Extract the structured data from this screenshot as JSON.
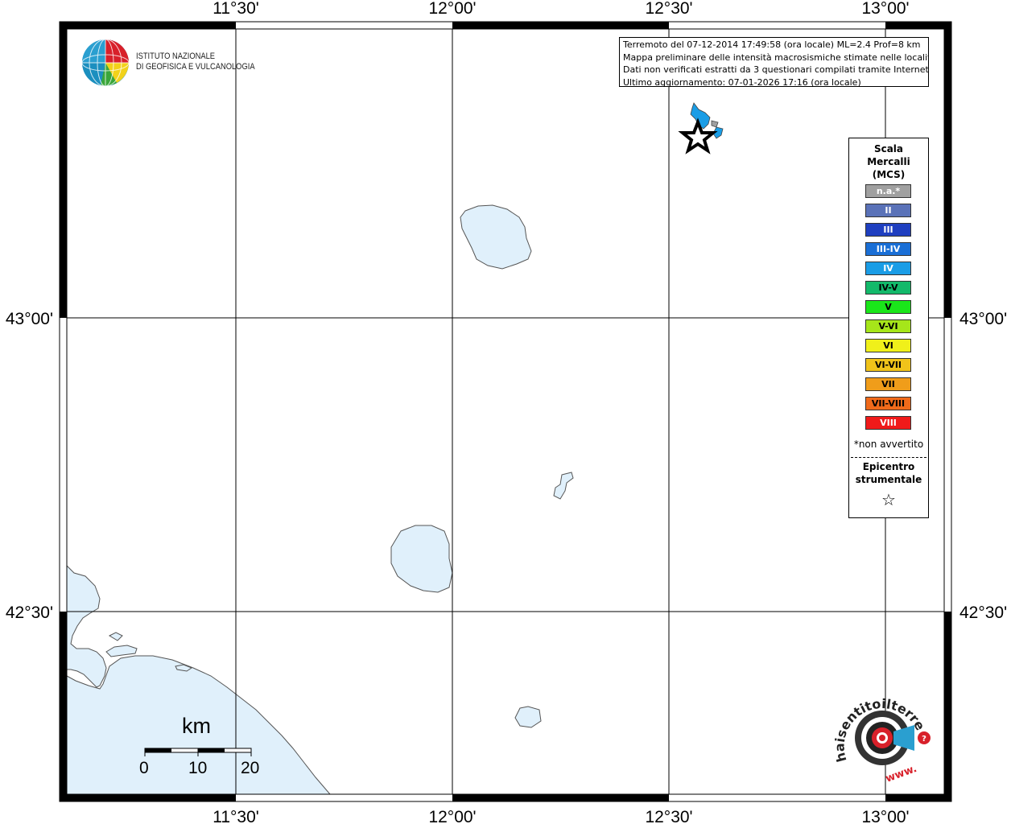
{
  "map": {
    "lon_labels": [
      "11°30'",
      "12°00'",
      "12°30'",
      "13°00'"
    ],
    "lat_labels": [
      "43°00'",
      "42°30'"
    ],
    "water_color": "#e0f0fb",
    "frame_color": "#000000"
  },
  "logo": {
    "line1": "ISTITUTO NAZIONALE",
    "line2": "DI GEOFISICA E VULCANOLOGIA",
    "icon": "globe-icon"
  },
  "info": {
    "line1": "Terremoto del 07-12-2014 17:49:58 (ora locale) ML=2.4 Prof=8 km",
    "line2": "Mappa preliminare delle intensità macrosismiche stimate nelle località",
    "line3": "Dati non verificati estratti da 3 questionari compilati tramite Internet.",
    "line4": "Ultimo aggiornamento: 07-01-2026 17:16 (ora locale)"
  },
  "legend": {
    "title1": "Scala",
    "title2": "Mercalli",
    "title3": "(MCS)",
    "items": [
      {
        "label": "n.a.*",
        "color": "#a0a0a0",
        "text": "#ffffff"
      },
      {
        "label": "II",
        "color": "#5a72b8",
        "text": "#ffffff"
      },
      {
        "label": "III",
        "color": "#1f3fc0",
        "text": "#ffffff"
      },
      {
        "label": "III-IV",
        "color": "#1a6fd6",
        "text": "#ffffff"
      },
      {
        "label": "IV",
        "color": "#1a9de6",
        "text": "#ffffff"
      },
      {
        "label": "IV-V",
        "color": "#13b96a",
        "text": "#000000"
      },
      {
        "label": "V",
        "color": "#1ae61a",
        "text": "#000000"
      },
      {
        "label": "V-VI",
        "color": "#a6e61a",
        "text": "#000000"
      },
      {
        "label": "VI",
        "color": "#f0f01a",
        "text": "#000000"
      },
      {
        "label": "VI-VII",
        "color": "#f0c31a",
        "text": "#000000"
      },
      {
        "label": "VII",
        "color": "#f09d1a",
        "text": "#000000"
      },
      {
        "label": "VII-VIII",
        "color": "#f06a1a",
        "text": "#000000"
      },
      {
        "label": "VIII",
        "color": "#f01a1a",
        "text": "#ffffff"
      }
    ],
    "note": "*non avvertito",
    "epicenter1": "Epicentro",
    "epicenter2": "strumentale",
    "epicenter_symbol": "☆"
  },
  "scalebar": {
    "unit": "km",
    "labels": [
      "0",
      "10",
      "20"
    ]
  },
  "watermark": {
    "text": "haisentitoilterremoto.it",
    "prefix": "www.",
    "icon": "earthquake-target-icon"
  }
}
